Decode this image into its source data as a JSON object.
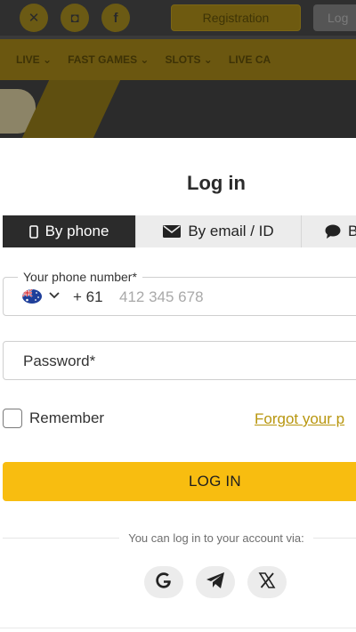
{
  "background": {
    "social_icons": [
      "x-icon",
      "instagram-icon",
      "facebook-icon"
    ],
    "register_label": "Registration",
    "login_label": "Log",
    "nav": [
      "LIVE ⌄",
      "FAST GAMES ⌄",
      "SLOTS ⌄",
      "LIVE CA"
    ]
  },
  "modal": {
    "title": "Log in",
    "tabs": [
      {
        "label": "By phone",
        "icon": "phone-icon",
        "active": true
      },
      {
        "label": "By email / ID",
        "icon": "envelope-icon",
        "active": false
      },
      {
        "label": "B",
        "icon": "chat-icon",
        "active": false
      }
    ],
    "phone": {
      "legend": "Your phone number*",
      "country_code": "+ 61",
      "placeholder": "412 345 678"
    },
    "password": {
      "placeholder": "Password*"
    },
    "remember_label": "Remember",
    "forgot_label": "Forgot your p",
    "submit_label": "LOG IN",
    "via_text": "You can log in to your account via:",
    "social_login": [
      "google-icon",
      "telegram-icon",
      "x-icon"
    ]
  },
  "colors": {
    "accent": "#f8bd10",
    "active_tab": "#2b2b2b",
    "link": "#b8960e"
  }
}
